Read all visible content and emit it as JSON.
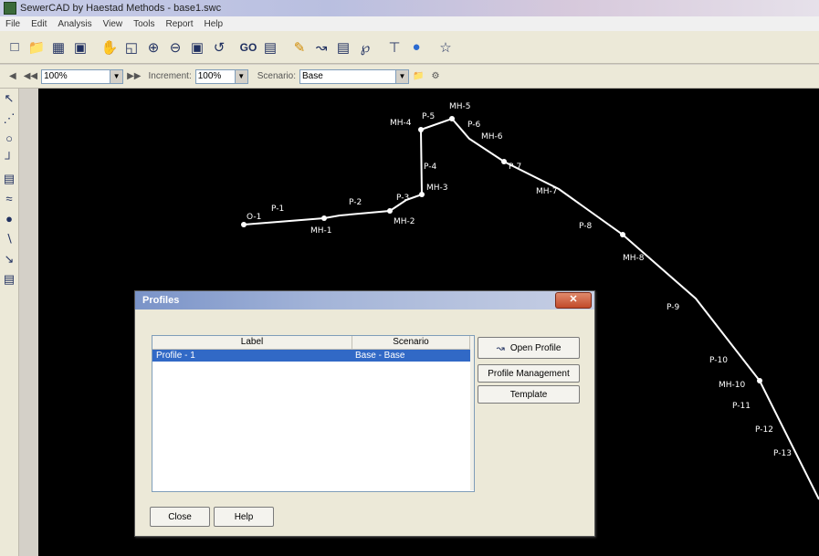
{
  "window": {
    "title": "SewerCAD by Haestad Methods - base1.swc"
  },
  "menu": [
    "File",
    "Edit",
    "Analysis",
    "View",
    "Tools",
    "Report",
    "Help"
  ],
  "toolbar2": {
    "zoom_value": "100%",
    "increment_label": "Increment:",
    "increment_value": "100%",
    "scenario_label": "Scenario:",
    "scenario_value": "Base"
  },
  "canvas": {
    "labels": [
      "O-1",
      "P-1",
      "MH-1",
      "P-2",
      "MH-2",
      "P-3",
      "MH-3",
      "P-4",
      "MH-4",
      "P-5",
      "MH-5",
      "P-6",
      "MH-6",
      "P-7",
      "MH-7",
      "P-8",
      "MH-8",
      "P-9",
      "P-10",
      "MH-10",
      "P-11",
      "P-12",
      "P-13"
    ]
  },
  "dialog": {
    "title": "Profiles",
    "col_label": "Label",
    "col_scenario": "Scenario",
    "row_label": "Profile - 1",
    "row_scenario": "Base - Base",
    "btn_open": "Open Profile",
    "btn_manager": "Profile Management",
    "btn_template": "Template",
    "btn_close": "Close",
    "btn_help": "Help"
  }
}
